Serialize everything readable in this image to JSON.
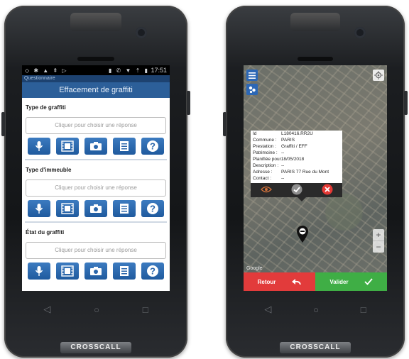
{
  "phone_left": {
    "status_bar": {
      "time": "17:51"
    },
    "app_name": "Questionnaire",
    "header_title": "Effacement de graffiti",
    "sections": [
      {
        "label": "Type de graffiti",
        "placeholder": "Cliquer pour choisir une réponse"
      },
      {
        "label": "Type d'immeuble",
        "placeholder": "Cliquer pour choisir une réponse"
      },
      {
        "label": "État du graffiti",
        "placeholder": "Cliquer pour choisir une réponse"
      }
    ],
    "tool_icons": [
      "microphone-icon",
      "film-icon",
      "camera-icon",
      "list-icon",
      "help-icon"
    ]
  },
  "phone_right": {
    "popup": {
      "rows": [
        {
          "key": "Id",
          "value": "L180416.RR2U"
        },
        {
          "key": "Commune :",
          "value": "PARIS"
        },
        {
          "key": "Prestation :",
          "value": "Graffiti / EFF"
        },
        {
          "key": "Patrimoine :",
          "value": "--"
        },
        {
          "key": "Planifiée pour",
          "value": "18/05/2018"
        },
        {
          "key": "Description :",
          "value": "--"
        },
        {
          "key": "Adresse :",
          "value": "PARIS 77 Rue du Mont"
        },
        {
          "key": "Contact :",
          "value": "--"
        }
      ]
    },
    "map_credit": "Google",
    "back_label": "Retour",
    "validate_label": "Valider",
    "colors": {
      "back": "#e23b3b",
      "validate": "#3fae45",
      "cancel": "#e53935"
    }
  },
  "nav": {
    "back": "◁",
    "home": "○",
    "recent": "□"
  },
  "brand": "CROSSCALL"
}
